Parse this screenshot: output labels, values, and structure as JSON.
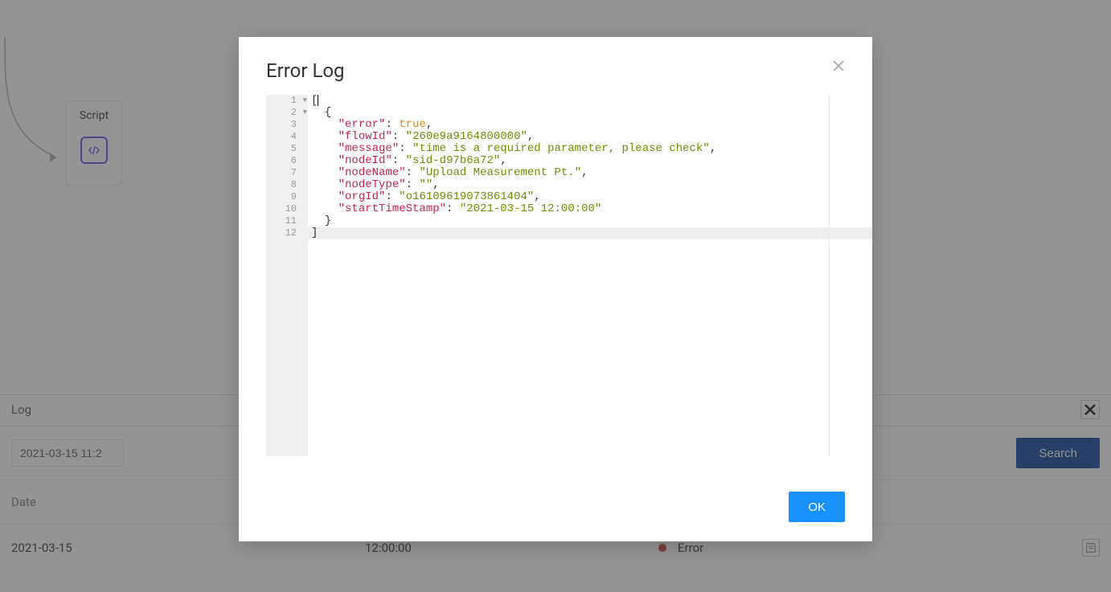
{
  "canvas": {
    "node_label": "Script"
  },
  "panel": {
    "title": "Log",
    "date_filter_value": "2021-03-15 11:2",
    "search_label": "Search",
    "columns": {
      "date": "Date"
    },
    "row": {
      "date": "2021-03-15",
      "time": "12:00:00",
      "status_label": "Error"
    }
  },
  "dialog": {
    "title": "Error Log",
    "ok_label": "OK",
    "line_numbers": [
      "1",
      "2",
      "3",
      "4",
      "5",
      "6",
      "7",
      "8",
      "9",
      "10",
      "11",
      "12"
    ],
    "log": {
      "error": "true",
      "flowId": "260e9a9164800000",
      "message": "time is a required parameter, please check",
      "nodeId": "sid-d97b6a72",
      "nodeName": "Upload Measurement Pt.",
      "nodeType": "",
      "orgId": "o16109619073861404",
      "startTimeStamp": "2021-03-15 12:00:00"
    },
    "keys": {
      "error": "error",
      "flowId": "flowId",
      "message": "message",
      "nodeId": "nodeId",
      "nodeName": "nodeName",
      "nodeType": "nodeType",
      "orgId": "orgId",
      "startTimeStamp": "startTimeStamp"
    }
  }
}
